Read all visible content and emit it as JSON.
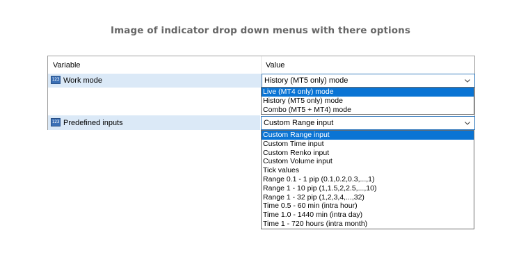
{
  "caption": "Image of indicator drop down menus with there options",
  "grid": {
    "header_variable": "Variable",
    "header_value": "Value"
  },
  "rows": [
    {
      "icon": "123",
      "label": "Work mode",
      "value": "History (MT5 only) mode",
      "options": [
        "Live (MT4 only) mode",
        "History (MT5 only) mode",
        "Combo (MT5 + MT4) mode"
      ],
      "highlighted": 0
    },
    {
      "icon": "123",
      "label": "Predefined inputs",
      "value": "Custom Range input",
      "options": [
        "Custom Range input",
        "Custom Time input",
        "Custom Renko input",
        "Custom Volume input",
        "Tick values",
        "Range 0.1 - 1 pip  (0.1,0.2,0.3,...,1)",
        "Range 1 - 10 pip  (1,1.5,2,2.5,...,10)",
        "Range 1 - 32 pip (1,2,3,4,...,32)",
        "Time 0.5 - 60 min (intra hour)",
        "Time 1.0 - 1440 min (intra day)",
        "Time 1 - 720 hours (intra month)"
      ],
      "highlighted": 0
    }
  ],
  "colors": {
    "row_highlight": "#dbe9f7",
    "selection": "#0a74d4",
    "combo_border": "#3c7fbf"
  }
}
